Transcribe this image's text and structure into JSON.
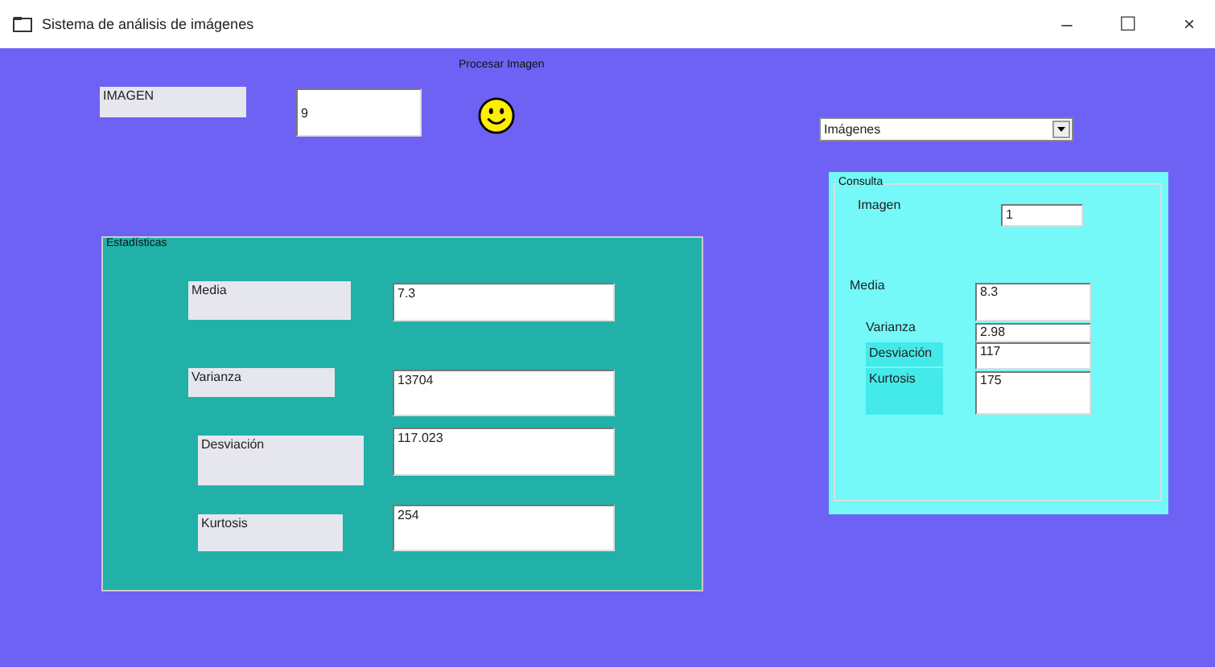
{
  "window": {
    "title": "Sistema de análisis de imágenes",
    "controls": [
      "–",
      "☐",
      "×"
    ]
  },
  "top": {
    "caption": "Procesar Imagen",
    "image_label": "IMAGEN",
    "image_value": "9"
  },
  "combo": {
    "value": "Imágenes"
  },
  "stats": {
    "title": "Estadísticas",
    "rows": [
      {
        "label": "Media",
        "value": "7.3"
      },
      {
        "label": "Varianza",
        "value": "13704"
      },
      {
        "label": "Desviación",
        "value": "117.023"
      },
      {
        "label": "Kurtosis",
        "value": "254"
      }
    ]
  },
  "consulta": {
    "title": "Consulta",
    "image_label": "Imagen",
    "image_value": "1",
    "rows": [
      {
        "label": "Media",
        "value": "8.3"
      },
      {
        "label": "Varianza",
        "value": "2.98"
      },
      {
        "label": "Desviación",
        "value": "117"
      },
      {
        "label": "Kurtosis",
        "value": "175"
      }
    ]
  }
}
